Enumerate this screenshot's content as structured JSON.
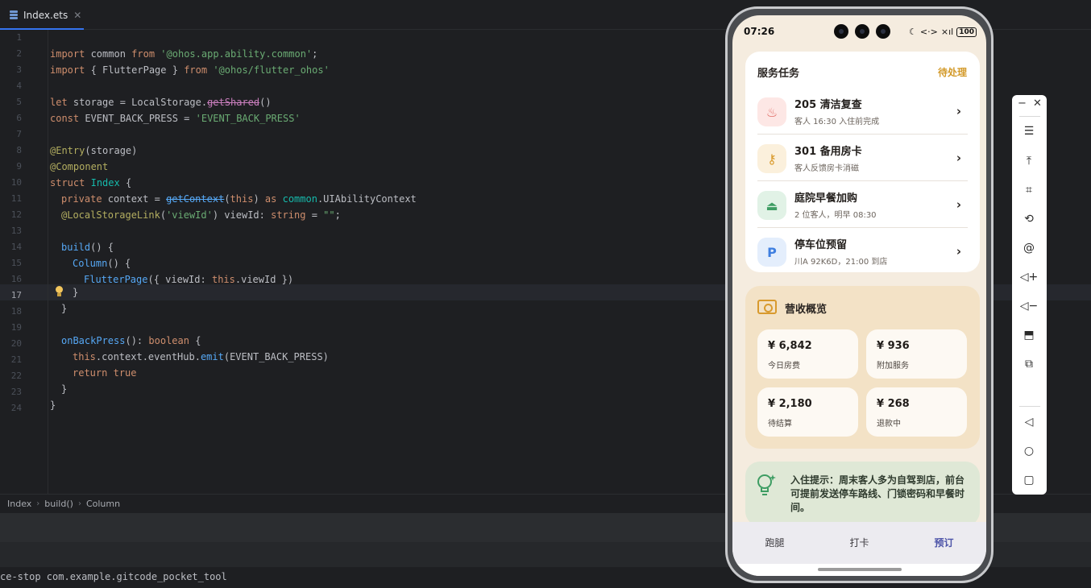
{
  "ide": {
    "tab": {
      "label": "Index.ets",
      "close": "✕"
    },
    "line_numbers": [
      "1",
      "2",
      "3",
      "4",
      "5",
      "6",
      "7",
      "8",
      "9",
      "10",
      "11",
      "12",
      "13",
      "14",
      "15",
      "16",
      "17",
      "18",
      "19",
      "20",
      "21",
      "22",
      "23",
      "24"
    ],
    "code": {
      "l2": [
        "import",
        " common ",
        "from",
        " ",
        "'@ohos.app.ability.common'",
        ";"
      ],
      "l3": [
        "import",
        " { FlutterPage } ",
        "from",
        " ",
        "'@ohos/flutter_ohos'"
      ],
      "l5": [
        "let",
        " storage = LocalStorage.",
        "getShared",
        "()"
      ],
      "l6": [
        "const",
        " EVENT_BACK_PRESS = ",
        "'EVENT_BACK_PRESS'"
      ],
      "l8": [
        "@Entry",
        "(storage)"
      ],
      "l9": [
        "@Component"
      ],
      "l10": [
        "struct",
        " ",
        "Index",
        " {"
      ],
      "l11": [
        "private",
        " context = ",
        "getContext",
        "(",
        "this",
        ") ",
        "as",
        " ",
        "common",
        ".UIAbilityContext"
      ],
      "l12": [
        "@LocalStorageLink",
        "(",
        "'viewId'",
        ") viewId: ",
        "string",
        " = ",
        "\"\"",
        ";"
      ],
      "l14": [
        "build",
        "() {"
      ],
      "l15": [
        "Column",
        "() {"
      ],
      "l16": [
        "FlutterPage",
        "({ viewId: ",
        "this",
        ".viewId })"
      ],
      "l17": [
        "}"
      ],
      "l18": [
        "}"
      ],
      "l20": [
        "onBackPress",
        "(): ",
        "boolean",
        " {"
      ],
      "l21": [
        "this",
        ".context.eventHub.",
        "emit",
        "(EVENT_BACK_PRESS)"
      ],
      "l22": [
        "return",
        " ",
        "true"
      ],
      "l23": [
        "}"
      ],
      "l24": [
        "}"
      ]
    },
    "breadcrumb": [
      "Index",
      "build()",
      "Column"
    ],
    "breadcrumb_sep": "›",
    "console_line": "ce-stop com.example.gitcode_pocket_tool"
  },
  "phone": {
    "status": {
      "time": "07:26",
      "moon": "☾",
      "link": "<·>",
      "signal": "×ıl",
      "battery": "100"
    },
    "tasks": {
      "title": "服务任务",
      "link": "待处理",
      "items": [
        {
          "title": "205 清洁复查",
          "sub": "客人 16:30 入住前完成",
          "icon": "broom-icon",
          "glyph": "♨",
          "bg": "#fde7e5",
          "fg": "#e16d67"
        },
        {
          "title": "301 备用房卡",
          "sub": "客人反馈房卡消磁",
          "icon": "key-icon",
          "glyph": "⚷",
          "bg": "#fbf0dc",
          "fg": "#d99a2b"
        },
        {
          "title": "庭院早餐加购",
          "sub": "2 位客人，明早 08:30",
          "icon": "dish-cover-icon",
          "glyph": "⏏",
          "bg": "#e1f2e6",
          "fg": "#3e9d63"
        },
        {
          "title": "停车位预留",
          "sub": "川A 92K6D，21:00 到店",
          "icon": "parking-icon",
          "glyph": "P",
          "bg": "#e4eefc",
          "fg": "#3f7fe0"
        }
      ],
      "chevron": "›"
    },
    "revenue": {
      "title": "营收概览",
      "tiles": [
        {
          "value": "¥ 6,842",
          "label": "今日房费"
        },
        {
          "value": "¥ 936",
          "label": "附加服务"
        },
        {
          "value": "¥ 2,180",
          "label": "待结算"
        },
        {
          "value": "¥ 268",
          "label": "退款中"
        }
      ]
    },
    "tip": {
      "text": "入住提示：周末客人多为自驾到店，前台可提前发送停车路线、门锁密码和早餐时间。"
    },
    "nav": [
      "跑腿",
      "打卡",
      "预订"
    ]
  },
  "emulator": {
    "minimize": "−",
    "close": "✕",
    "buttons": [
      "menu-icon",
      "pin-top-icon",
      "crop-icon",
      "rotate-icon",
      "at-icon",
      "volume-up-icon",
      "volume-down-icon",
      "screenshot-icon",
      "multi-device-icon",
      "back-icon",
      "home-icon",
      "recents-icon"
    ],
    "glyphs": [
      "☰",
      "⤒",
      "⌗",
      "⟲",
      "@",
      "◁+",
      "◁−",
      "⬒",
      "⧉",
      "◁",
      "○",
      "▢"
    ]
  },
  "colors": {
    "accent": "#3574f0",
    "phone_bg": "#f5ecdf",
    "warn": "#d39a2a",
    "nav_active": "#4d54a8"
  }
}
